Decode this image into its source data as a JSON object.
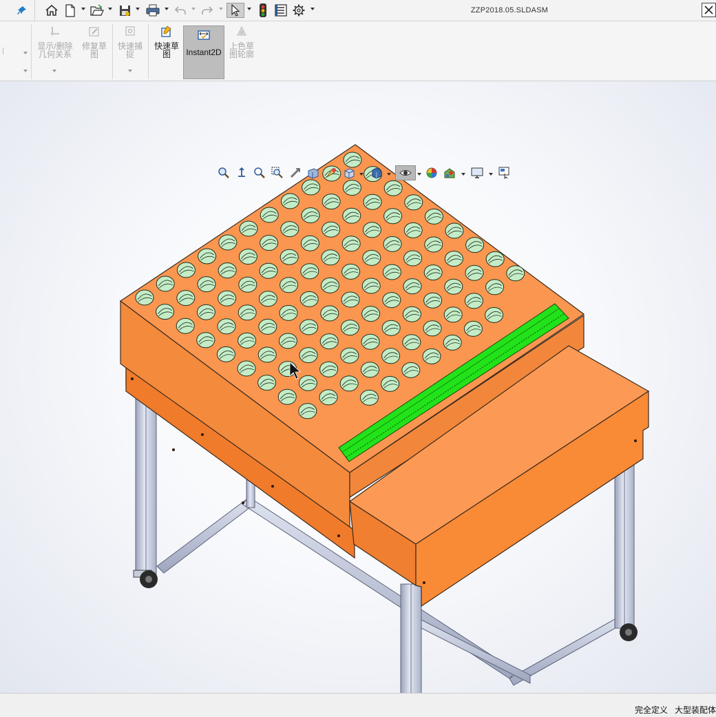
{
  "window": {
    "title": "ZZP2018.05.SLDASM"
  },
  "quick_access": [
    {
      "name": "pin",
      "icon": "pin-icon"
    },
    {
      "name": "home",
      "icon": "home-icon"
    },
    {
      "name": "new",
      "icon": "new-document-icon"
    },
    {
      "name": "open",
      "icon": "open-folder-icon"
    },
    {
      "name": "save",
      "icon": "save-icon"
    },
    {
      "name": "print",
      "icon": "print-icon"
    },
    {
      "name": "undo",
      "icon": "undo-icon"
    },
    {
      "name": "redo",
      "icon": "redo-icon"
    },
    {
      "name": "select",
      "icon": "select-cursor-icon"
    },
    {
      "name": "rebuild",
      "icon": "traffic-light-icon"
    },
    {
      "name": "file-properties",
      "icon": "file-properties-icon"
    },
    {
      "name": "options",
      "icon": "gear-icon"
    }
  ],
  "ribbon": {
    "display_delete_relations": "显示/删除\n几何关系",
    "repair_sketch": "修复草\n图",
    "quick_snaps": "快速捕\n捉",
    "rapid_sketch": "快速草\n图",
    "instant2d": "Instant2D",
    "shaded_sketch_contours": "上色草\n图轮廓"
  },
  "view_toolbar": [
    {
      "name": "zoom-to-fit",
      "icon": "zoom-to-fit-icon"
    },
    {
      "name": "zoom-to-area",
      "icon": "zoom-area-icon"
    },
    {
      "name": "zoom-in-out",
      "icon": "zoom-icon"
    },
    {
      "name": "zoom-selection",
      "icon": "zoom-selection-icon"
    },
    {
      "name": "previous-view",
      "icon": "previous-view-icon"
    },
    {
      "name": "section-view",
      "icon": "section-view-icon"
    },
    {
      "name": "dynamic-annotation",
      "icon": "dynamic-annotation-icon"
    },
    {
      "name": "view-orientation",
      "icon": "view-orientation-icon"
    },
    {
      "name": "display-style",
      "icon": "display-style-icon"
    },
    {
      "name": "hide-show-items",
      "icon": "eye-icon"
    },
    {
      "name": "edit-appearance",
      "icon": "appearance-icon"
    },
    {
      "name": "apply-scene",
      "icon": "scene-icon"
    },
    {
      "name": "view-settings",
      "icon": "monitor-icon"
    },
    {
      "name": "screen-capture",
      "icon": "screen-capture-icon"
    }
  ],
  "colors": {
    "body_orange": "#f5893d",
    "body_orange_dark": "#e8731e",
    "top_orange": "#fb9650",
    "slot_green": "#c4ecc7",
    "rail_green": "#22e31a",
    "frame_gray": "#a4acc4",
    "frame_light": "#d9dfee"
  },
  "status": {
    "state": "完全定义",
    "mode": "大型装配体"
  }
}
